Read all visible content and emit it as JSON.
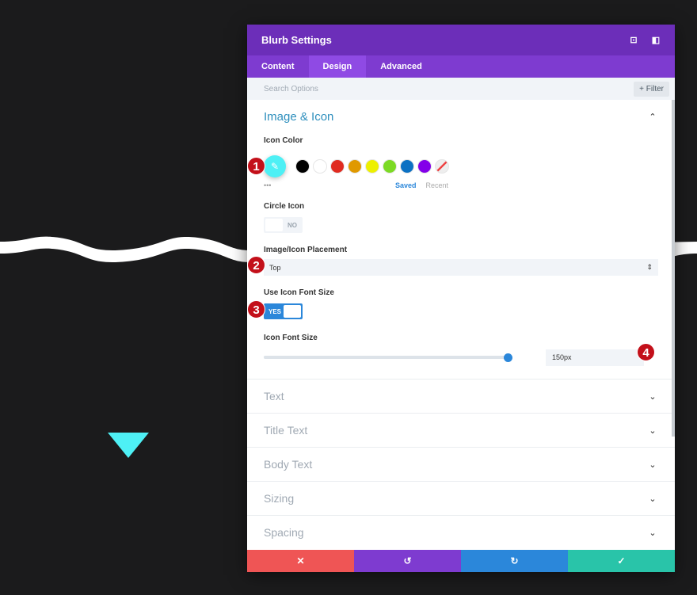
{
  "modal": {
    "title": "Blurb Settings",
    "header_icons": [
      "fullscreen-icon",
      "sidebar-toggle-icon"
    ]
  },
  "tabs": [
    {
      "label": "Content"
    },
    {
      "label": "Design",
      "active": true
    },
    {
      "label": "Advanced"
    }
  ],
  "search": {
    "placeholder": "Search Options",
    "filter_label": "+ Filter"
  },
  "section": {
    "title": "Image & Icon",
    "expanded": true,
    "icon_color": {
      "label": "Icon Color",
      "selected": "#4ef0f5",
      "swatches": [
        "#000000",
        "#ffffff",
        "#e02b20",
        "#e09900",
        "#edf000",
        "#7cda24",
        "#0c71c3",
        "#8300e9"
      ],
      "more": "•••",
      "saved": "Saved",
      "recent": "Recent"
    },
    "circle_icon": {
      "label": "Circle Icon",
      "value": "NO"
    },
    "placement": {
      "label": "Image/Icon Placement",
      "value": "Top"
    },
    "use_font_size": {
      "label": "Use Icon Font Size",
      "value": "YES"
    },
    "font_size": {
      "label": "Icon Font Size",
      "value": "150px",
      "slider_fraction": 0.99
    }
  },
  "collapsed_sections": [
    "Text",
    "Title Text",
    "Body Text",
    "Sizing",
    "Spacing"
  ],
  "badges": [
    "1",
    "2",
    "3",
    "4"
  ],
  "footer": {
    "colors": {
      "cancel": "#ef5555",
      "undo": "#7e3bd0",
      "redo": "#2b87da",
      "save": "#29c4a9"
    }
  },
  "colors": {
    "accent": "#6c2eb9",
    "tab_bar": "#7e3bd0",
    "blue": "#2b87da",
    "badge": "#c3101a"
  }
}
